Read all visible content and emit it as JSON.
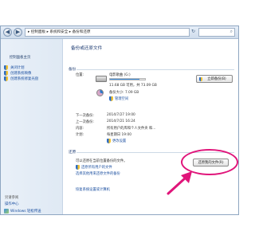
{
  "address": {
    "path": "▸ 控制面板 ▸ 系统和安全 ▸ 备份和还原",
    "nav_back": "◀",
    "nav_forward": "▶"
  },
  "sidebar": {
    "home_link": "控制面板主页",
    "items": [
      {
        "label": "关闭计划"
      },
      {
        "label": "创建系统映像"
      },
      {
        "label": "创建系统修复光盘"
      }
    ],
    "see_also_title": "另请参阅",
    "see_also": [
      {
        "label": "操作中心"
      },
      {
        "label": "Windows 轻松传送"
      }
    ]
  },
  "main": {
    "title": "备份或还原文件",
    "backup": {
      "section_label": "备份",
      "location_label": "位置:",
      "drive_name": "电影歌曲 (G:)",
      "free_space": "11.68 GB 可用，共 73.09 GB",
      "backup_size": "备份大小: 7.09 GB",
      "manage_space": "管理空间",
      "backup_now_button": "立即备份(B)",
      "next_backup_label": "下一次备份:",
      "next_backup_value": "2014/7/27 19:00",
      "last_backup_label": "上一次备份:",
      "last_backup_value": "2014/7/21 16:24",
      "contents_label": "内容:",
      "contents_value": "所有用户的库和个人文件夹 和...",
      "schedule_label": "计划:",
      "schedule_value": "每星期日 19:00",
      "change_settings": "更改设置",
      "usage_fraction": 0.84
    },
    "restore": {
      "section_label": "还原",
      "description": "可以还原在当前位置备份的文件。",
      "restore_all_users": "还原所有用户的文件",
      "select_other_backup": "选择其他用来还原文件的备份",
      "recover_system": "恢复系统设置或计算机",
      "restore_my_files_button": "还原我的文件(R)"
    }
  },
  "colors": {
    "highlight": "#e0157a",
    "link": "#1b4fa0"
  }
}
